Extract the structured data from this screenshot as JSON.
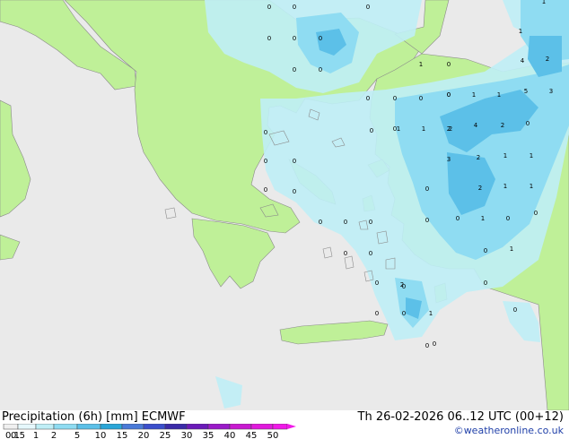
{
  "map": {
    "colors": {
      "sea": "#eaeaea",
      "land": "#bff098",
      "precip_light": "#bfeef6",
      "precip_medium": "#8fdcf2",
      "precip_heavy": "#5cc0e8"
    },
    "values": [
      {
        "t": "0"
      },
      {
        "t": "0"
      },
      {
        "t": "0"
      },
      {
        "t": "1"
      },
      {
        "t": "0"
      },
      {
        "t": "0"
      },
      {
        "t": "0"
      },
      {
        "t": "1"
      },
      {
        "t": "0"
      },
      {
        "t": "0"
      },
      {
        "t": "1"
      },
      {
        "t": "0"
      },
      {
        "t": "0"
      },
      {
        "t": "4"
      },
      {
        "t": "2"
      },
      {
        "t": "0"
      },
      {
        "t": "0"
      },
      {
        "t": "0"
      },
      {
        "t": "0"
      },
      {
        "t": "0"
      },
      {
        "t": "2"
      },
      {
        "t": "1"
      },
      {
        "t": "1"
      },
      {
        "t": "5"
      },
      {
        "t": "3"
      },
      {
        "t": "0"
      },
      {
        "t": "1"
      },
      {
        "t": "1"
      },
      {
        "t": "2"
      },
      {
        "t": "4"
      },
      {
        "t": "2"
      },
      {
        "t": "0"
      },
      {
        "t": "0"
      },
      {
        "t": "0"
      },
      {
        "t": "0"
      },
      {
        "t": "3"
      },
      {
        "t": "2"
      },
      {
        "t": "1"
      },
      {
        "t": "1"
      },
      {
        "t": "0"
      },
      {
        "t": "0"
      },
      {
        "t": "0"
      },
      {
        "t": "2"
      },
      {
        "t": "1"
      },
      {
        "t": "1"
      },
      {
        "t": "0"
      },
      {
        "t": "0"
      },
      {
        "t": "0"
      },
      {
        "t": "0"
      },
      {
        "t": "1"
      },
      {
        "t": "0"
      },
      {
        "t": "0"
      },
      {
        "t": "0"
      },
      {
        "t": "0"
      },
      {
        "t": "0"
      },
      {
        "t": "0"
      },
      {
        "t": "0"
      },
      {
        "t": "1"
      },
      {
        "t": "0"
      },
      {
        "t": "0"
      },
      {
        "t": "2"
      },
      {
        "t": "0"
      },
      {
        "t": "0"
      },
      {
        "t": "1"
      },
      {
        "t": "0"
      },
      {
        "t": "0"
      },
      {
        "t": "0"
      }
    ]
  },
  "footer": {
    "title": "Precipitation (6h) [mm] ECMWF",
    "datetime": "Th 26-02-2026 06..12 UTC (00+12)",
    "credit": "©weatheronline.co.uk"
  },
  "legend": {
    "ticks": [
      "0.1",
      "0.5",
      "1",
      "2",
      "5",
      "10",
      "15",
      "20",
      "25",
      "30",
      "35",
      "40",
      "45",
      "50"
    ],
    "colors": [
      "#f0f0f0",
      "#e6f8fc",
      "#bfeef6",
      "#8fdcf2",
      "#5cc0e8",
      "#2aa6d8",
      "#4a7ad8",
      "#3a4ecc",
      "#3a2aa8",
      "#6a1ab8",
      "#9a1ac8",
      "#c81ad0",
      "#e01adc",
      "#f01ae8"
    ]
  }
}
